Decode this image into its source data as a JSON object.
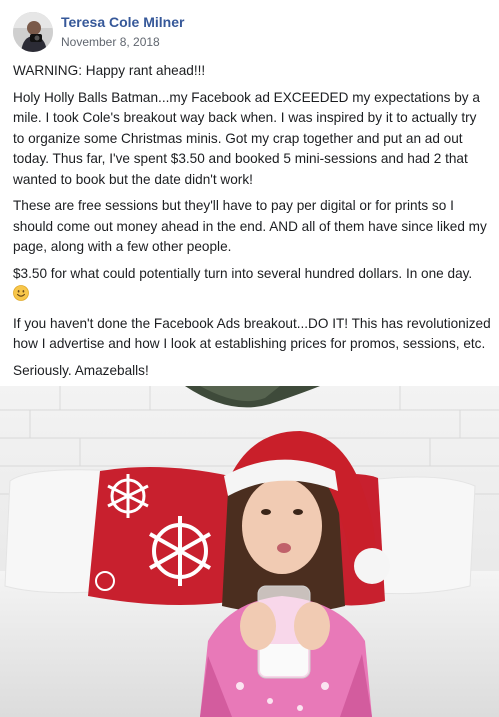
{
  "post": {
    "author": "Teresa Cole Milner",
    "date": "November 8, 2018",
    "paragraphs": [
      "WARNING: Happy rant ahead!!!",
      "Holy Holly Balls Batman...my Facebook ad EXCEEDED my expectations by a mile. I took Cole's breakout way back when. I was inspired by it to actually try to organize some Christmas minis. Got my crap together and put an ad out today. Thus far, I've spent $3.50 and booked 5 mini-sessions and had 2 that wanted to book but the date didn't work!",
      "These are free sessions but they'll have to pay per digital or for prints so I should come out money ahead in the end. AND all of them have since liked my page, along with a few other people.",
      "$3.50 for what could potentially turn into several hundred dollars. In one day.",
      "If you haven't done the Facebook Ads breakout...DO IT! This has revolutionized how I advertise and how I look at establishing prices for promos, sessions, etc.",
      "Seriously. Amazeballs!"
    ],
    "emoji": "smiling-face-emoji"
  },
  "colors": {
    "author_link": "#365899",
    "meta_text": "#616770",
    "body_text": "#1c1e21",
    "pillow_red": "#c8202e",
    "hat_red": "#c91f2a",
    "pajama_pink": "#e879b8"
  }
}
